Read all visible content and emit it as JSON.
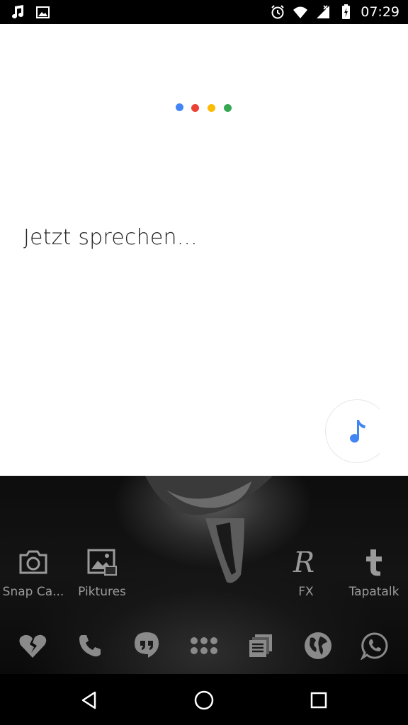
{
  "status_bar": {
    "time": "07:29",
    "left_icons": [
      "music-note-icon",
      "image-icon"
    ],
    "right_icons": [
      "alarm-icon",
      "wifi-icon",
      "signal-icon",
      "battery-icon"
    ]
  },
  "voice_search": {
    "prompt": "Jetzt sprechen...",
    "dot_colors": [
      "#4285F4",
      "#EA4335",
      "#FBBC05",
      "#34A853"
    ],
    "music_button_icon": "music-note-icon",
    "accent_color": "#4285F4"
  },
  "home_apps": [
    {
      "label": "Snap Ca...",
      "icon": "camera-icon"
    },
    {
      "label": "Piktures",
      "icon": "gallery-icon"
    },
    {
      "label": "FX",
      "icon": "fx-icon"
    },
    {
      "label": "Tapatalk",
      "icon": "tapatalk-icon"
    }
  ],
  "dock": [
    {
      "icon": "broken-heart-icon"
    },
    {
      "icon": "phone-icon"
    },
    {
      "icon": "hangouts-icon"
    },
    {
      "icon": "app-drawer-icon"
    },
    {
      "icon": "news-icon"
    },
    {
      "icon": "globe-icon"
    },
    {
      "icon": "whatsapp-icon"
    }
  ],
  "nav": {
    "back_icon": "back-icon",
    "home_icon": "home-icon",
    "recents_icon": "recents-icon"
  }
}
